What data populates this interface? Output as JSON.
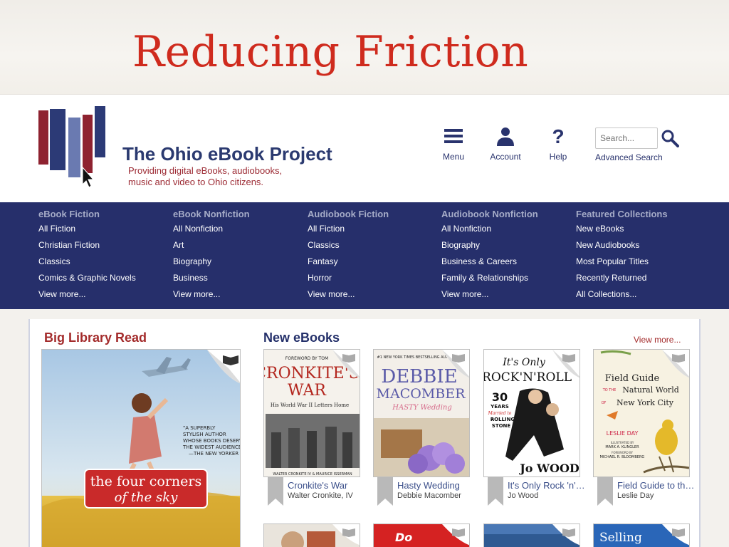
{
  "slide": {
    "title": "Reducing Friction"
  },
  "header": {
    "site_name": "The Ohio eBook Project",
    "tagline_line1": "Providing digital eBooks, audiobooks,",
    "tagline_line2": "music and video to Ohio citizens.",
    "menu_label": "Menu",
    "account_label": "Account",
    "help_label": "Help",
    "help_glyph": "?",
    "search_placeholder": "Search...",
    "advanced_search": "Advanced Search"
  },
  "nav": {
    "columns": [
      {
        "heading": "eBook Fiction",
        "links": [
          "All Fiction",
          "Christian Fiction",
          "Classics",
          "Comics & Graphic Novels",
          "View more..."
        ]
      },
      {
        "heading": "eBook Nonfiction",
        "links": [
          "All Nonfiction",
          "Art",
          "Biography",
          "Business",
          "View more..."
        ]
      },
      {
        "heading": "Audiobook Fiction",
        "links": [
          "All Fiction",
          "Classics",
          "Fantasy",
          "Horror",
          "View more..."
        ]
      },
      {
        "heading": "Audiobook Nonfiction",
        "links": [
          "All Nonfiction",
          "Biography",
          "Business & Careers",
          "Family & Relationships",
          "View more..."
        ]
      },
      {
        "heading": "Featured Collections",
        "links": [
          "New eBooks",
          "New Audiobooks",
          "Most Popular Titles",
          "Recently Returned",
          "All Collections..."
        ]
      }
    ]
  },
  "big_library_read": {
    "title": "Big Library Read",
    "cover": {
      "book_title_l1": "the four corners",
      "book_title_l2": "of the sky",
      "blurb_l1": "\"A SUPERBLY",
      "blurb_l2": "STYLISH AUTHOR",
      "blurb_l3": "WHOSE BOOKS DESERVE",
      "blurb_l4": "THE WIDEST AUDIENCE.\"",
      "blurb_l5": "—THE NEW YORKER"
    }
  },
  "new_ebooks": {
    "title": "New eBooks",
    "view_more": "View more...",
    "books": [
      {
        "title": "Cronkite's War",
        "author": "Walter Cronkite, IV",
        "cover_top": "FOREWORD BY TOM",
        "cover_l1": "CRONKITE'S",
        "cover_l2": "WAR",
        "cover_sub": "His World War II Letters Home",
        "cover_bottom": "WALTER CRONKITE IV & MAURICE ISSERMAN"
      },
      {
        "title": "Hasty Wedding",
        "author": "Debbie Macomber",
        "cover_top": "#1 NEW YORK TIMES BESTSELLING AUTHOR",
        "cover_l1": "DEBBIE",
        "cover_l2": "MACOMBER",
        "cover_sub": "HASTY Wedding"
      },
      {
        "title": "It's Only Rock 'n' Roll",
        "author": "Jo Wood",
        "cover_l1": "It's Only",
        "cover_l2": "ROCK'N'ROLL",
        "cover_num": "30",
        "cover_years": "YEARS",
        "cover_married": "Married to",
        "cover_a": "A",
        "cover_rolling": "ROLLING",
        "cover_stone": "STONE",
        "cover_bottom": "Jo WOOD"
      },
      {
        "title": "Field Guide to the Natural World of New York City",
        "author": "Leslie Day",
        "cover_l1": "Field Guide",
        "cover_to": "TO THE",
        "cover_l2": "Natural World",
        "cover_of": "OF",
        "cover_l3": "New York City",
        "cover_author": "LESLIE DAY",
        "cover_ill": "ILLUSTRATED BY",
        "cover_ill_name": "MARK A. KLINGLER",
        "cover_fwd": "FOREWORD BY",
        "cover_fwd_name": "MICHAEL R. BLOOMBERG"
      }
    ],
    "row2": [
      {
        "cover_text_l1": ""
      },
      {
        "cover_text_l1": "Do"
      },
      {
        "cover_text_l1": ""
      },
      {
        "cover_text_l1": "Selling"
      }
    ]
  },
  "colors": {
    "slide_title": "#cf2b1e",
    "nav_band": "#262f6b",
    "nav_heading": "#a6acc8",
    "brand_blue": "#2b3a70",
    "brand_red": "#9c2a33"
  }
}
